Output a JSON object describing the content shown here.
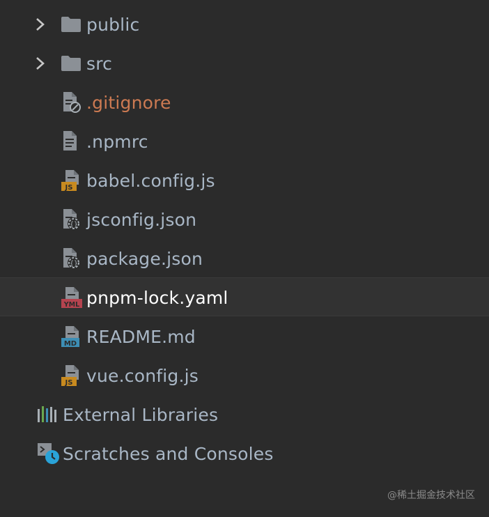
{
  "project_tree": {
    "items": [
      {
        "label": "public",
        "type": "folder",
        "icon": "folder-icon"
      },
      {
        "label": "src",
        "type": "folder",
        "icon": "folder-icon"
      },
      {
        "label": ".gitignore",
        "type": "file",
        "icon": "ignored-file-icon"
      },
      {
        "label": ".npmrc",
        "type": "file",
        "icon": "text-file-icon"
      },
      {
        "label": "babel.config.js",
        "type": "file",
        "icon": "js-file-icon",
        "badge": "JS"
      },
      {
        "label": "jsconfig.json",
        "type": "file",
        "icon": "json-file-icon"
      },
      {
        "label": "package.json",
        "type": "file",
        "icon": "json-file-icon"
      },
      {
        "label": "pnpm-lock.yaml",
        "type": "file",
        "icon": "yaml-file-icon",
        "badge": "YML",
        "selected": true
      },
      {
        "label": "README.md",
        "type": "file",
        "icon": "markdown-file-icon",
        "badge": "MD"
      },
      {
        "label": "vue.config.js",
        "type": "file",
        "icon": "js-file-icon",
        "badge": "JS"
      }
    ],
    "external_libraries": "External Libraries",
    "scratches": "Scratches and Consoles"
  },
  "watermark": "@稀土掘金技术社区",
  "colors": {
    "background": "#2b2b2b",
    "selected_row": "#323232",
    "text": "#a9b7c6",
    "ignored_text": "#cc7a52",
    "selected_text": "#ffffff",
    "folder": "#8b9096",
    "js_badge": "#c88a1f",
    "yml_badge": "#b5434f",
    "md_badge": "#3d8eb5",
    "clock": "#2aa3d8"
  }
}
